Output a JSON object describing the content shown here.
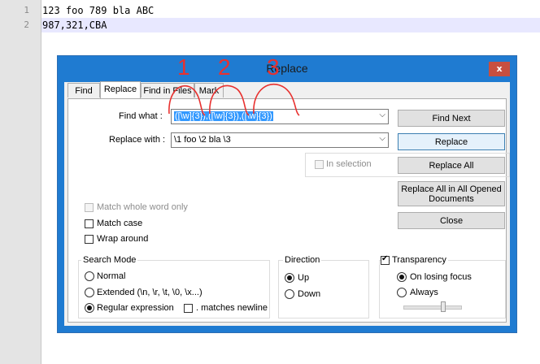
{
  "editor": {
    "lines": [
      {
        "num": "1",
        "text": "123 foo 789 bla ABC"
      },
      {
        "num": "2",
        "text": "987,321,CBA"
      }
    ]
  },
  "dialog": {
    "title": "Replace",
    "close_label": "x",
    "tabs": [
      {
        "label": "Find"
      },
      {
        "label": "Replace"
      },
      {
        "label": "Find in Files"
      },
      {
        "label": "Mark"
      }
    ],
    "find_what_label": "Find what :",
    "find_what_value": "([\\w]{3}),([\\w]{3}),([\\w]{3})",
    "replace_with_label": "Replace with :",
    "replace_with_value": "\\1 foo \\2 bla \\3",
    "in_selection_label": "In selection",
    "buttons": {
      "find_next": "Find Next",
      "replace": "Replace",
      "replace_all": "Replace All",
      "replace_all_opened": "Replace All in All Opened Documents",
      "close": "Close"
    },
    "options": {
      "match_whole_word": "Match whole word only",
      "match_case": "Match case",
      "wrap_around": "Wrap around"
    },
    "search_mode": {
      "label": "Search Mode",
      "normal": "Normal",
      "extended": "Extended (\\n, \\r, \\t, \\0, \\x...)",
      "regex": "Regular expression",
      "matches_newline": ". matches newline"
    },
    "direction": {
      "label": "Direction",
      "up": "Up",
      "down": "Down"
    },
    "transparency": {
      "label": "Transparency",
      "on_losing_focus": "On losing focus",
      "always": "Always"
    }
  },
  "annotations": [
    "1",
    "2",
    "3"
  ],
  "colors": {
    "dialog_frame": "#1f7bd1",
    "annotation": "#e8312f",
    "selection": "#3399ff"
  }
}
